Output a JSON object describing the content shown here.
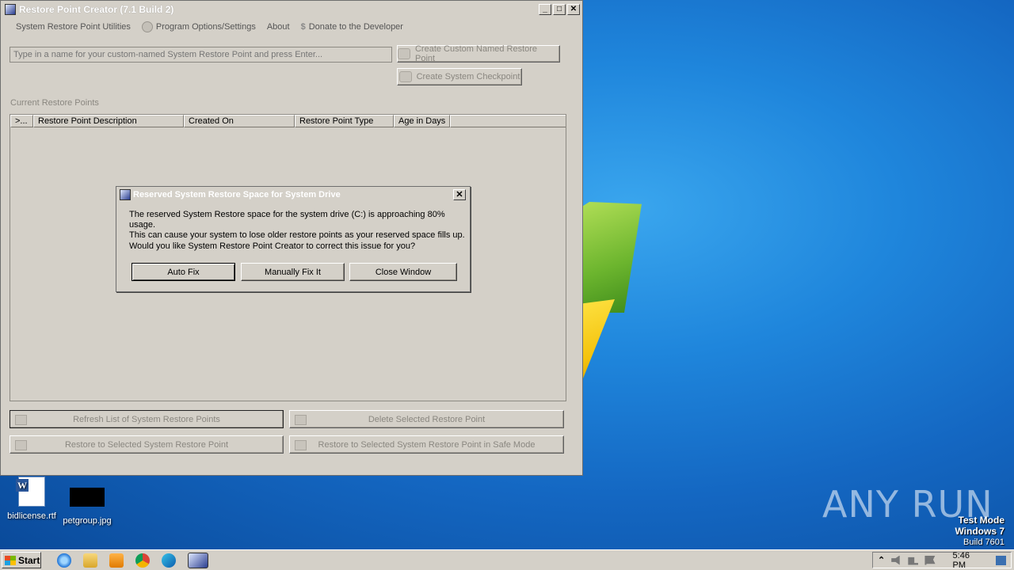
{
  "window": {
    "title": "Restore Point Creator (7.1 Build 2)",
    "controls": {
      "minimize": "_",
      "maximize": "□",
      "close": "✕"
    }
  },
  "menu": [
    {
      "label": "System Restore Point Utilities",
      "icon": ""
    },
    {
      "label": "Program Options/Settings",
      "icon": "gear-icon"
    },
    {
      "label": "About",
      "icon": ""
    },
    {
      "label": "Donate to the Developer",
      "icon": "dollar-icon"
    }
  ],
  "name_input": {
    "placeholder": "Type in a name for your custom-named System Restore Point and press Enter..."
  },
  "buttons": {
    "create_named": "Create Custom Named Restore Point",
    "create_checkpoint": "Create System Checkpoint",
    "refresh": "Refresh List of System Restore Points",
    "delete": "Delete Selected Restore Point",
    "restore": "Restore to Selected System Restore Point",
    "restore_safe": "Restore to Selected System Restore Point in Safe Mode"
  },
  "list": {
    "group_label": "Current Restore Points",
    "columns": [
      ">...",
      "Restore Point Description",
      "Created On",
      "Restore Point Type",
      "Age in Days"
    ]
  },
  "dialog": {
    "title": "Reserved System Restore Space for System Drive",
    "close": "✕",
    "message_line1": "The reserved System Restore space for the system drive (C:) is approaching 80% usage.",
    "message_line2": "This can cause your system to lose older restore points as your reserved space fills up.",
    "question": "Would you like System Restore Point Creator to correct this issue for you?",
    "buttons": {
      "auto_fix": "Auto Fix",
      "manual_fix": "Manually Fix It",
      "close": "Close Window"
    }
  },
  "desktop_icons": [
    {
      "label": "bidlicense.rtf",
      "icon": "word-document-icon"
    },
    {
      "label": "petgroup.jpg",
      "icon": "image-file-icon"
    }
  ],
  "watermark": {
    "brand": "ANY RUN",
    "test_mode": "Test Mode",
    "os": "Windows 7",
    "build": "Build 7601"
  },
  "taskbar": {
    "start_label": "Start",
    "clock": "5:46 PM",
    "pinned": [
      "internet-explorer-icon",
      "explorer-folder-icon",
      "media-player-icon",
      "chrome-icon",
      "edge-icon",
      "restore-point-creator-icon"
    ]
  }
}
